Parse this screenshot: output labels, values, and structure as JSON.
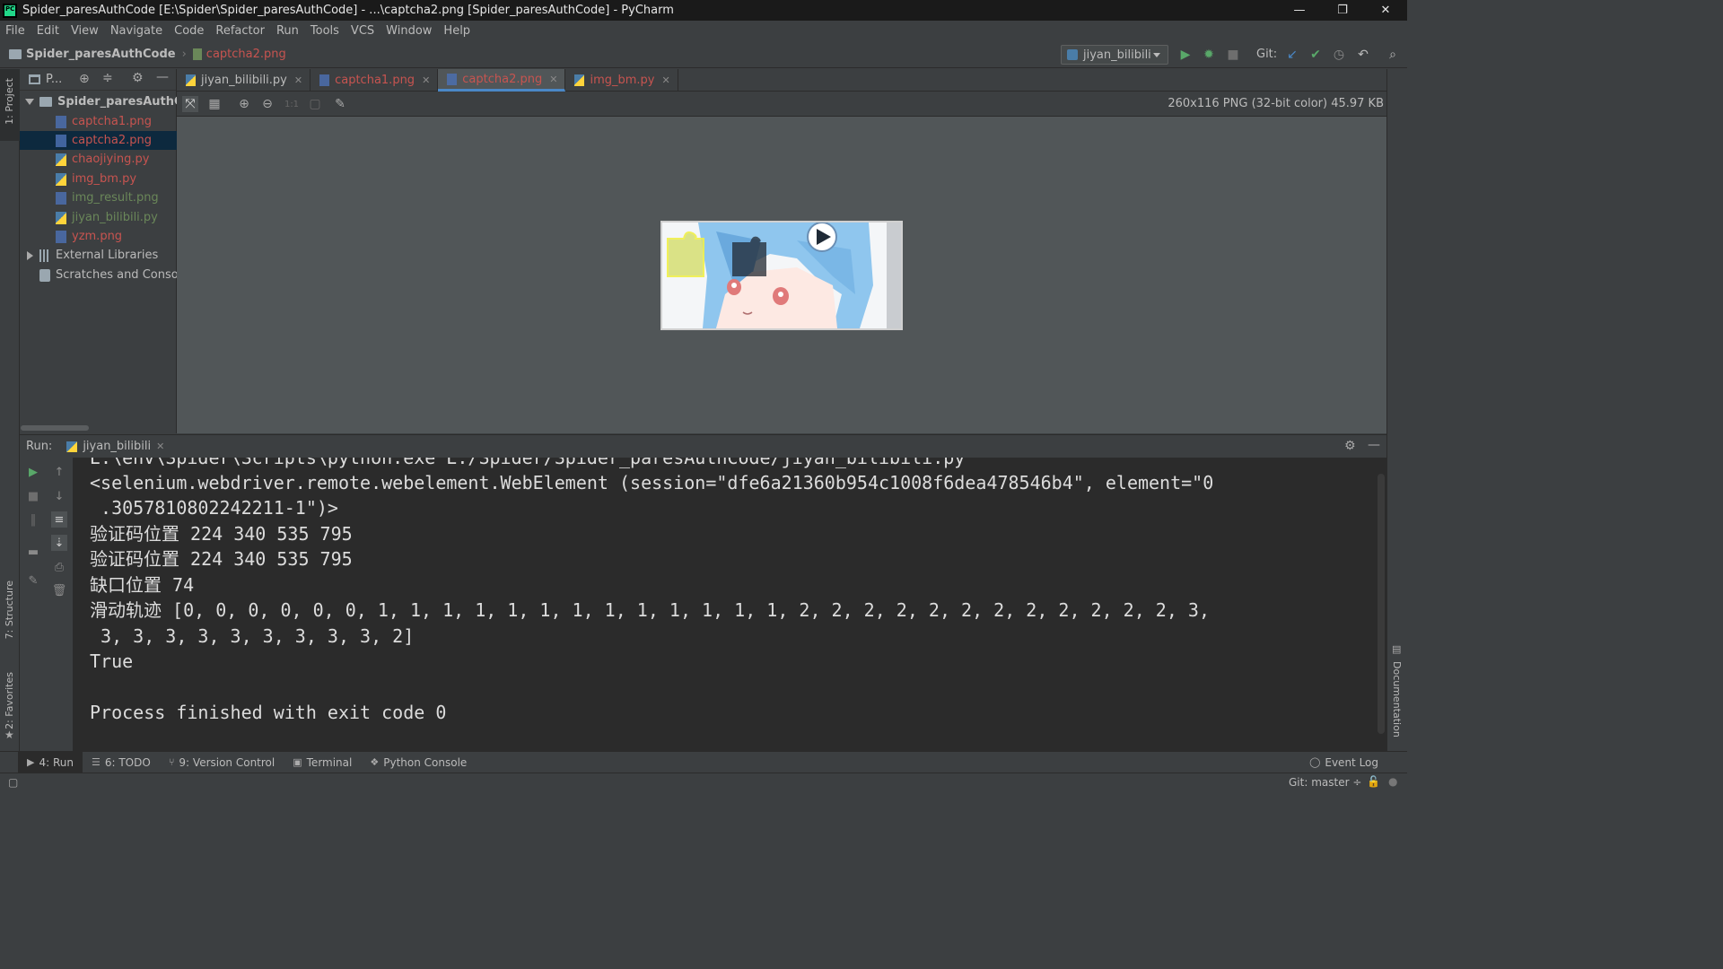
{
  "window": {
    "title": "Spider_paresAuthCode [E:\\Spider\\Spider_paresAuthCode] - ...\\captcha2.png [Spider_paresAuthCode] - PyCharm"
  },
  "menu": [
    "File",
    "Edit",
    "View",
    "Navigate",
    "Code",
    "Refactor",
    "Run",
    "Tools",
    "VCS",
    "Window",
    "Help"
  ],
  "navbar": {
    "project": "Spider_paresAuthCode",
    "file": "captcha2.png",
    "run_config": "jiyan_bilibili",
    "git_label": "Git:"
  },
  "left_stripe": {
    "project_tab": "1: Project",
    "structure_tab": "7: Structure",
    "favorites_tab": "2: Favorites"
  },
  "right_stripe": {
    "documentation_tab": "Documentation"
  },
  "project_panel": {
    "header": "P...",
    "root": "Spider_paresAuthCod",
    "files": [
      {
        "name": "captcha1.png",
        "type": "png"
      },
      {
        "name": "captcha2.png",
        "type": "png"
      },
      {
        "name": "chaojiying.py",
        "type": "py"
      },
      {
        "name": "img_bm.py",
        "type": "py"
      },
      {
        "name": "img_result.png",
        "type": "png"
      },
      {
        "name": "jiyan_bilibili.py",
        "type": "py"
      },
      {
        "name": "yzm.png",
        "type": "png"
      }
    ],
    "external_libraries": "External Libraries",
    "scratches": "Scratches and Console"
  },
  "tabs": [
    {
      "label": "jiyan_bilibili.py",
      "active": false
    },
    {
      "label": "captcha1.png",
      "active": false
    },
    {
      "label": "captcha2.png",
      "active": true
    },
    {
      "label": "img_bm.py",
      "active": false
    }
  ],
  "image_toolbar": {
    "zoom_actual": "1:1",
    "info": "260x116 PNG (32-bit color) 45.97 KB"
  },
  "run_panel": {
    "label": "Run:",
    "tab": "jiyan_bilibili",
    "console_lines": [
      "E:\\env\\Spider\\Scripts\\python.exe E:/Spider/Spider_paresAuthCode/jiyan_bilibili.py",
      "<selenium.webdriver.remote.webelement.WebElement (session=\"dfe6a21360b954c1008f6dea478546b4\", element=\"0",
      " .3057810802242211-1\")>",
      "验证码位置 224 340 535 795",
      "验证码位置 224 340 535 795",
      "缺口位置 74",
      "滑动轨迹 [0, 0, 0, 0, 0, 0, 1, 1, 1, 1, 1, 1, 1, 1, 1, 1, 1, 1, 1, 2, 2, 2, 2, 2, 2, 2, 2, 2, 2, 2, 2, 3,",
      " 3, 3, 3, 3, 3, 3, 3, 3, 3, 2]",
      "True",
      "",
      "Process finished with exit code 0"
    ]
  },
  "bottom_tools": [
    {
      "label": "4: Run",
      "icon": "play-icon",
      "glyph": "▶",
      "active": true
    },
    {
      "label": "6: TODO",
      "icon": "todo-icon",
      "glyph": "☰",
      "active": false
    },
    {
      "label": "9: Version Control",
      "icon": "vcs-icon",
      "glyph": "⑂",
      "active": false
    },
    {
      "label": "Terminal",
      "icon": "terminal-icon",
      "glyph": "▣",
      "active": false
    },
    {
      "label": "Python Console",
      "icon": "python-icon",
      "glyph": "❖",
      "active": false
    }
  ],
  "event_log": "Event Log",
  "status": {
    "git_branch": "Git: master ÷"
  },
  "colors": {
    "accent": "#4a88c7",
    "error_file": "#c75450",
    "run_green": "#59a869",
    "background": "#3c3f41",
    "console_bg": "#2b2b2b",
    "image_bg": "#515658"
  }
}
